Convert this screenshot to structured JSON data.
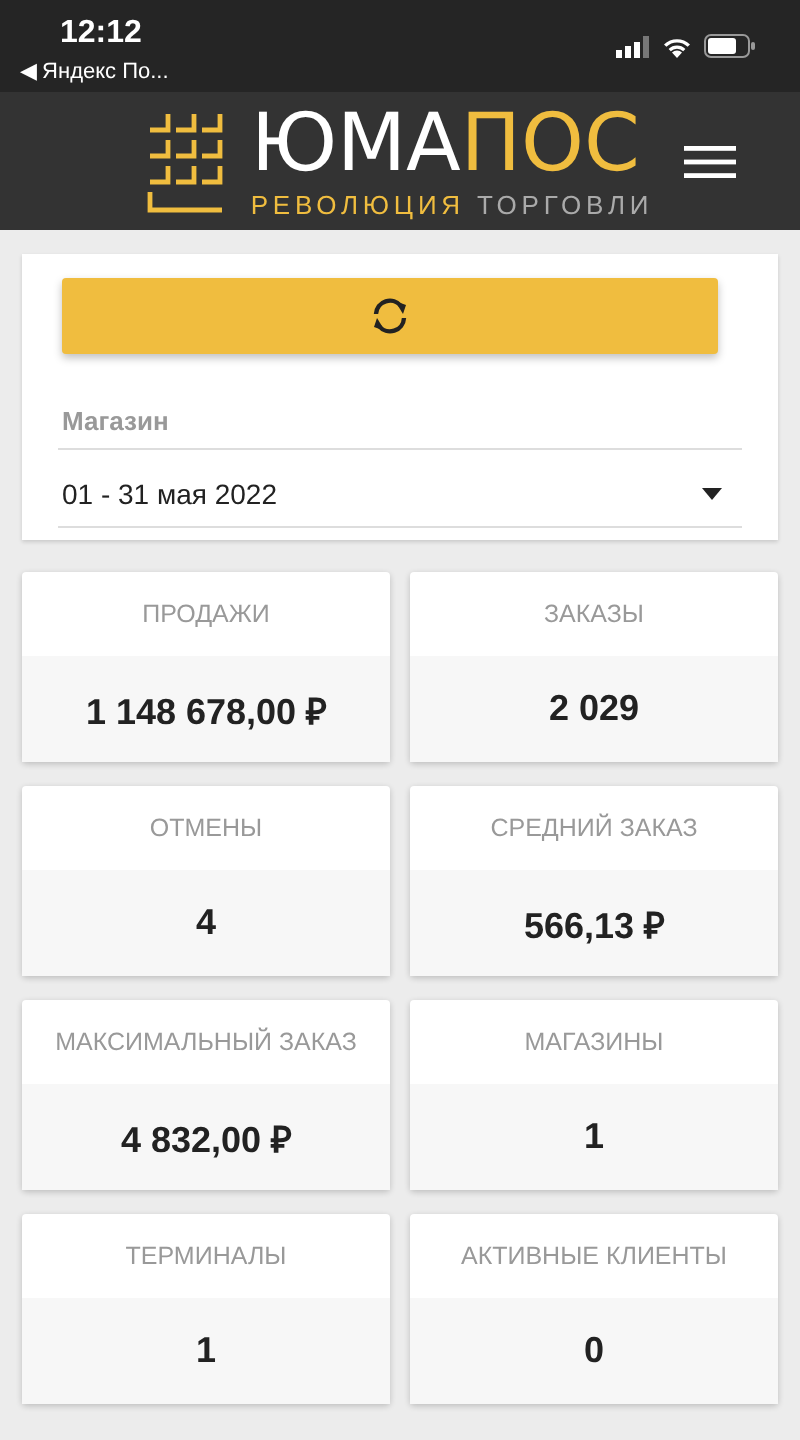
{
  "status_bar": {
    "time": "12:12",
    "back_link": "◀ Яндекс По..."
  },
  "header": {
    "logo": {
      "name_white": "ЮМА",
      "name_yellow": "ПОС",
      "tagline_yellow": "РЕВОЛЮЦИЯ",
      "tagline_grey": "ТОРГОВЛИ"
    }
  },
  "filters": {
    "store_field": {
      "placeholder": "Магазин"
    },
    "period": {
      "value": "01 - 31 мая 2022"
    }
  },
  "stats": [
    {
      "label": "ПРОДАЖИ",
      "value": "1 148 678,00 ₽"
    },
    {
      "label": "ЗАКАЗЫ",
      "value": "2 029"
    },
    {
      "label": "ОТМЕНЫ",
      "value": "4"
    },
    {
      "label": "СРЕДНИЙ ЗАКАЗ",
      "value": "566,13 ₽"
    },
    {
      "label": "МАКСИМАЛЬНЫЙ ЗАКАЗ",
      "value": "4 832,00 ₽"
    },
    {
      "label": "МАГАЗИНЫ",
      "value": "1"
    },
    {
      "label": "ТЕРМИНАЛЫ",
      "value": "1"
    },
    {
      "label": "АКТИВНЫЕ КЛИЕНТЫ",
      "value": "0"
    }
  ]
}
